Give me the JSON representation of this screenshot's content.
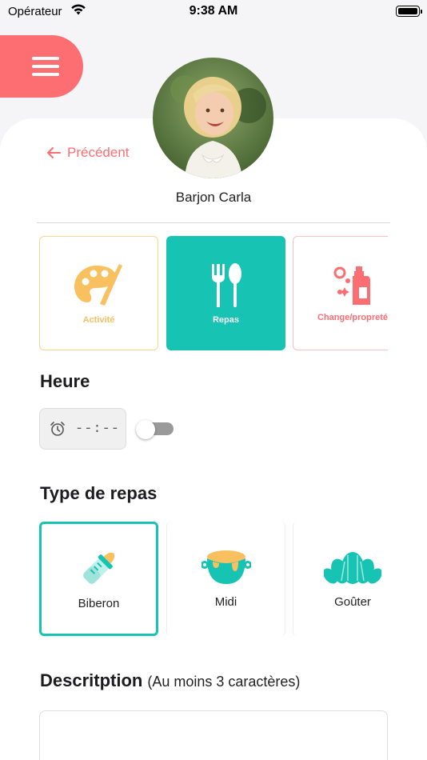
{
  "status_bar": {
    "carrier": "Opérateur",
    "time": "9:38 AM"
  },
  "header": {
    "back_label": "Précédent",
    "child_name": "Barjon Carla"
  },
  "categories": [
    {
      "label": "Activité",
      "icon": "palette-icon",
      "selected": false,
      "color": "#f9c060"
    },
    {
      "label": "Repas",
      "icon": "fork-spoon-icon",
      "selected": true,
      "color": "#17c3b2"
    },
    {
      "label": "Change/propreté",
      "icon": "hygiene-icon",
      "selected": false,
      "color": "#fd6e72"
    }
  ],
  "heure": {
    "title": "Heure",
    "value": "--:--",
    "toggle_on": false
  },
  "meal_type": {
    "title": "Type de repas",
    "options": [
      {
        "label": "Biberon",
        "icon": "baby-bottle-icon",
        "selected": true
      },
      {
        "label": "Midi",
        "icon": "pot-icon",
        "selected": false
      },
      {
        "label": "Goûter",
        "icon": "croissant-icon",
        "selected": false
      }
    ]
  },
  "description": {
    "title": "Descritption",
    "hint": "(Au moins 3 caractères)",
    "value": ""
  },
  "colors": {
    "accent_teal": "#17c3b2",
    "accent_coral": "#fd6e72",
    "accent_yellow": "#f9c060"
  }
}
